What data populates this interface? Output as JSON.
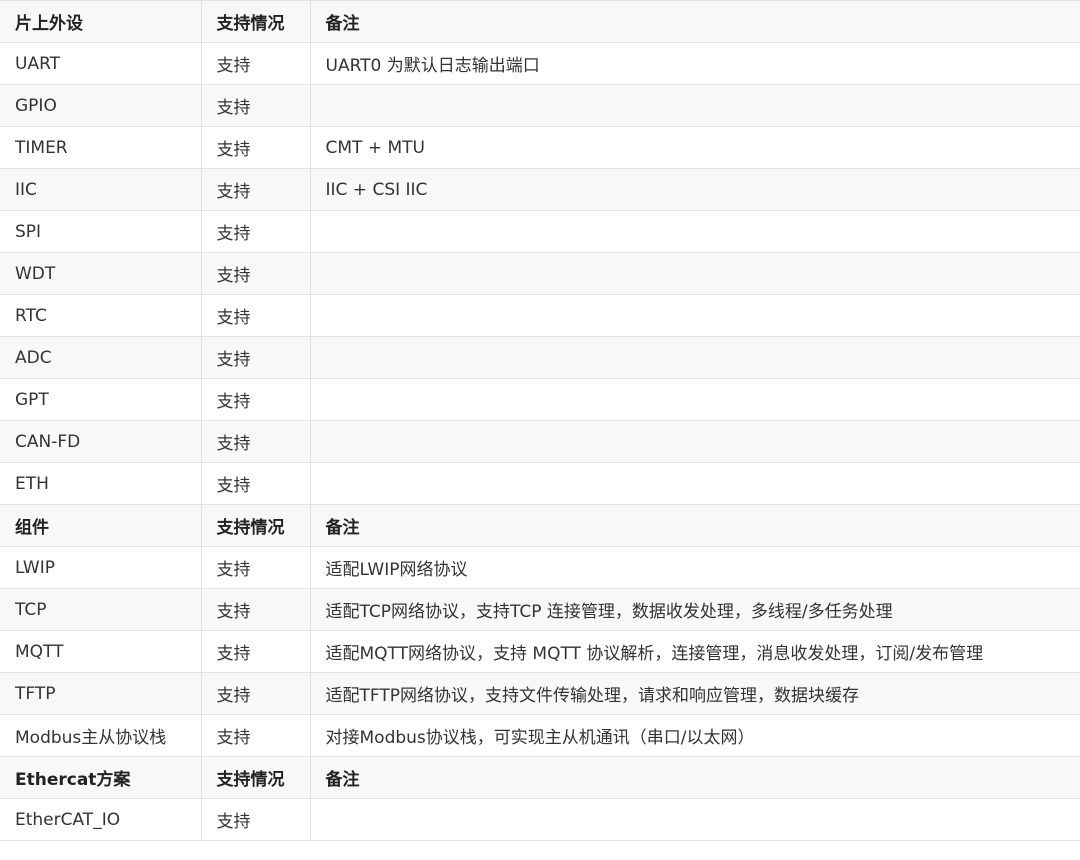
{
  "sections": [
    {
      "header": [
        "片上外设",
        "支持情况",
        "备注"
      ],
      "rows": [
        [
          "UART",
          "支持",
          "UART0 为默认日志输出端口"
        ],
        [
          "GPIO",
          "支持",
          ""
        ],
        [
          "TIMER",
          "支持",
          "CMT + MTU"
        ],
        [
          "IIC",
          "支持",
          "IIC + CSI IIC"
        ],
        [
          "SPI",
          "支持",
          ""
        ],
        [
          "WDT",
          "支持",
          ""
        ],
        [
          "RTC",
          "支持",
          ""
        ],
        [
          "ADC",
          "支持",
          ""
        ],
        [
          "GPT",
          "支持",
          ""
        ],
        [
          "CAN-FD",
          "支持",
          ""
        ],
        [
          "ETH",
          "支持",
          ""
        ]
      ]
    },
    {
      "header": [
        "组件",
        "支持情况",
        "备注"
      ],
      "rows": [
        [
          "LWIP",
          "支持",
          "适配LWIP网络协议"
        ],
        [
          "TCP",
          "支持",
          "适配TCP网络协议，支持TCP 连接管理，数据收发处理，多线程/多任务处理"
        ],
        [
          "MQTT",
          "支持",
          "适配MQTT网络协议，支持 MQTT 协议解析，连接管理，消息收发处理，订阅/发布管理"
        ],
        [
          "TFTP",
          "支持",
          "适配TFTP网络协议，支持文件传输处理，请求和响应管理，数据块缓存"
        ],
        [
          "Modbus主从协议栈",
          "支持",
          "对接Modbus协议栈，可实现主从机通讯（串口/以太网）"
        ]
      ]
    },
    {
      "header": [
        "Ethercat方案",
        "支持情况",
        "备注"
      ],
      "rows": [
        [
          "EtherCAT_IO",
          "支持",
          ""
        ]
      ]
    }
  ]
}
